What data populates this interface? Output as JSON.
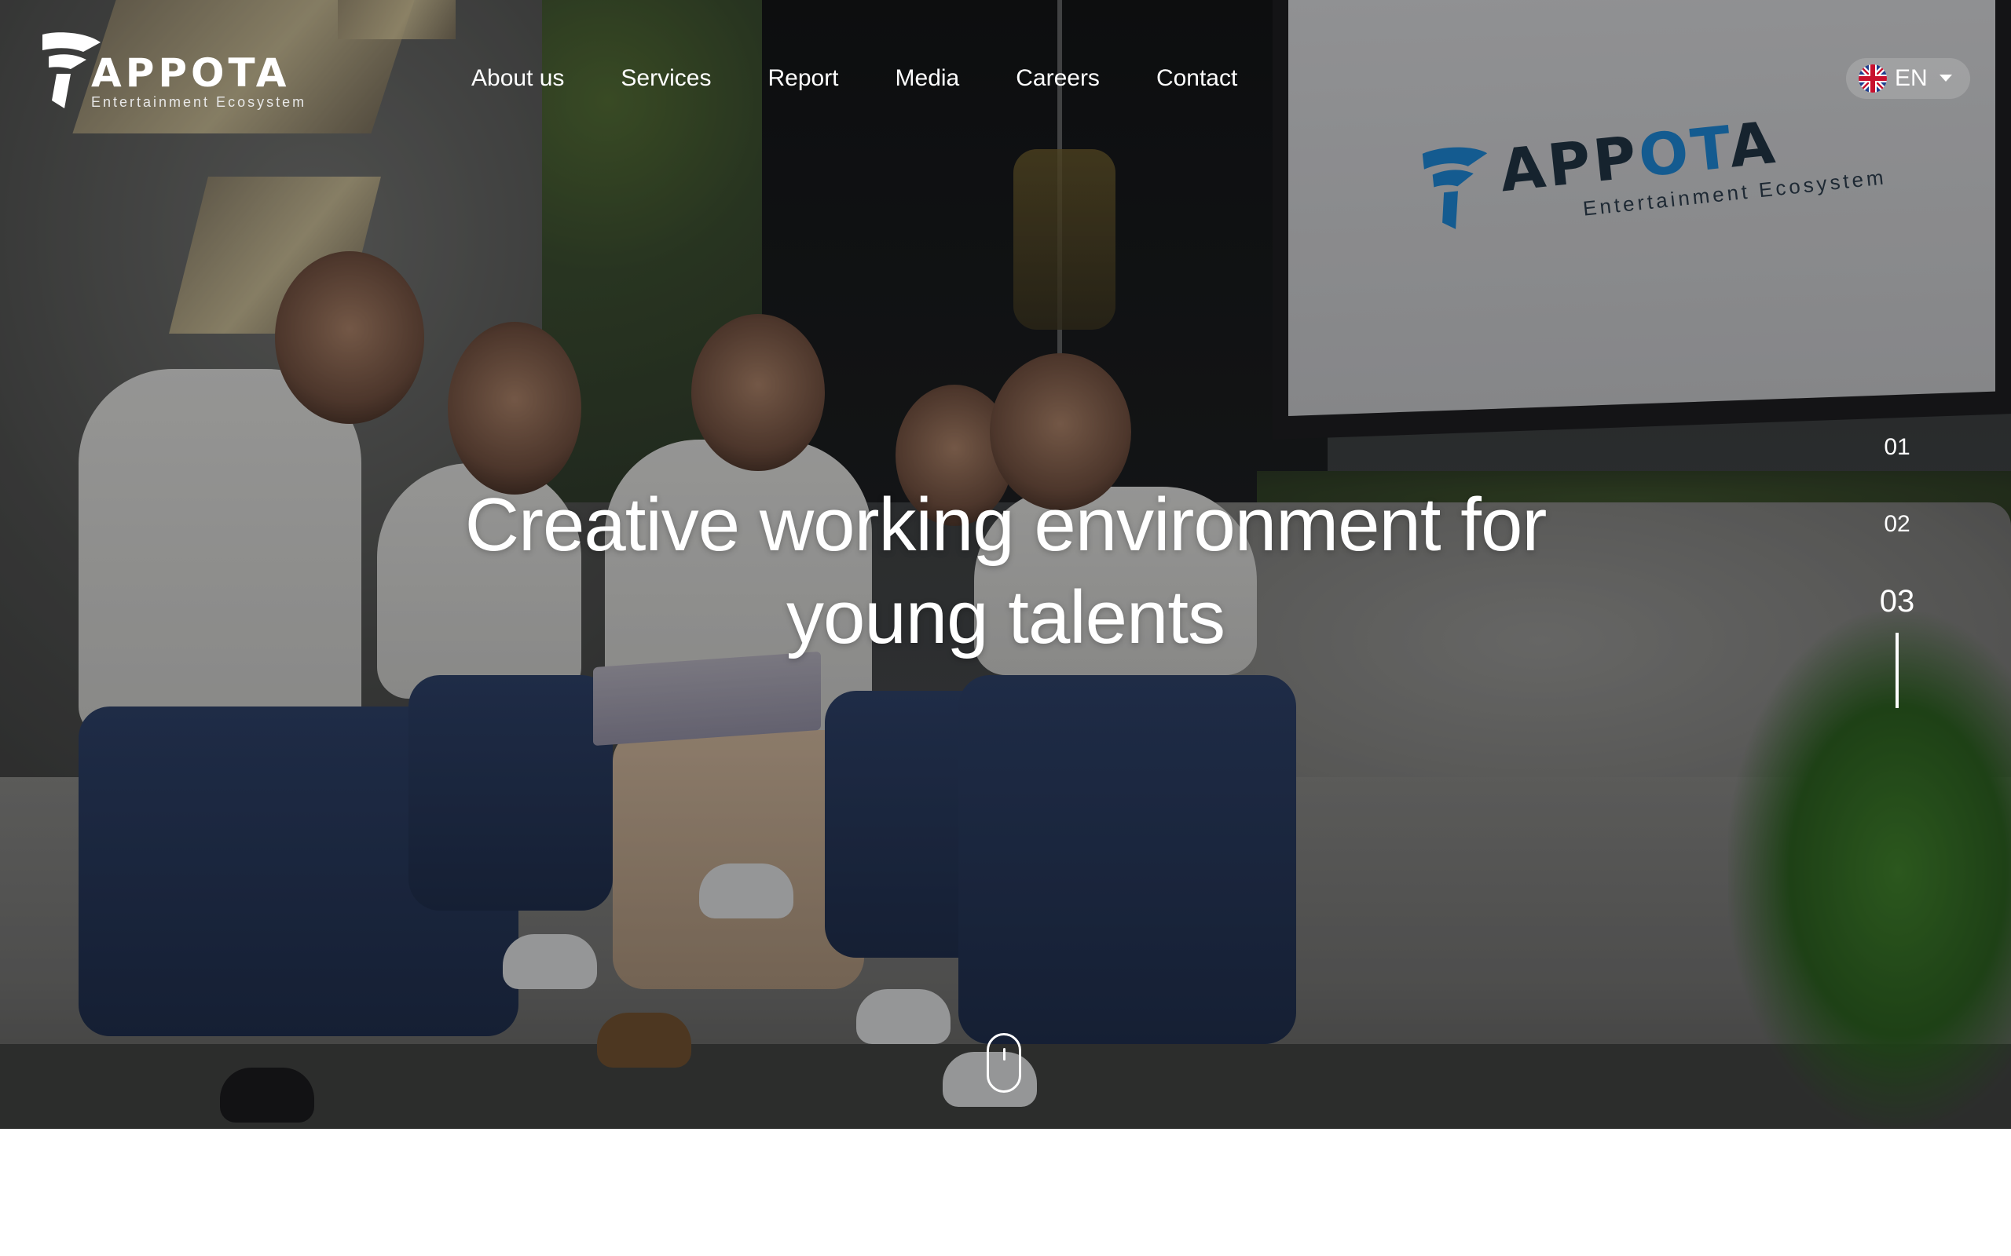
{
  "header": {
    "logo": {
      "brand": "APPOTA",
      "tagline": "Entertainment Ecosystem"
    },
    "nav": [
      {
        "label": "About us"
      },
      {
        "label": "Services"
      },
      {
        "label": "Report"
      },
      {
        "label": "Media"
      },
      {
        "label": "Careers"
      },
      {
        "label": "Contact"
      }
    ],
    "language": {
      "label": "EN",
      "icon": "uk-flag-icon"
    }
  },
  "hero": {
    "headline_line1": "Creative working environment for",
    "headline_line2": "young talents",
    "screen_logo": {
      "brand_dark": "APP",
      "brand_blue": "OT",
      "brand_end": "A",
      "tagline": "Entertainment Ecosystem"
    }
  },
  "slides": [
    {
      "label": "01",
      "active": false
    },
    {
      "label": "02",
      "active": false
    },
    {
      "label": "03",
      "active": true
    }
  ],
  "scroll_indicator": {
    "icon": "mouse-scroll-icon"
  },
  "colors": {
    "text": "#ffffff",
    "brand_blue": "#1c7fc8",
    "page_background": "#ffffff"
  }
}
